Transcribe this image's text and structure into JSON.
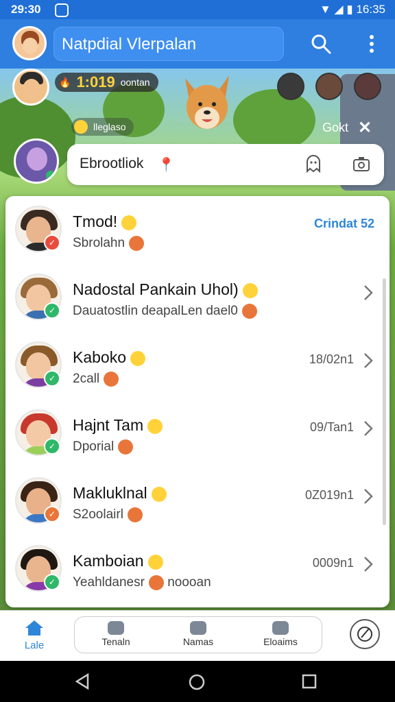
{
  "status_bar": {
    "time": "29:30",
    "right_time": "16:35"
  },
  "app_bar": {
    "title": "Natpdial Vlerpalan"
  },
  "story": {
    "count": "1:019",
    "badge_text": "oontan"
  },
  "activity": {
    "pill_text": "lleglaso",
    "close_label": "Gokt"
  },
  "composer": {
    "text": "Ebrootliok"
  },
  "chats": [
    {
      "name": "Tmod!",
      "message": "Sbrolahn",
      "time": "Crindat 52",
      "hair": "#3a2a22",
      "skin": "#e9b58e",
      "shirt": "#2b2b2b",
      "badge": "#e84c3d"
    },
    {
      "name": "Nadostal Pankain Uhol)",
      "message": "Dauatostlin deapalLen dael0",
      "time": "",
      "hair": "#9a6a3a",
      "skin": "#f1c6a0",
      "shirt": "#3a6fb0",
      "badge": "#2fb86a"
    },
    {
      "name": "Kaboko",
      "message": "2call",
      "time": "18/02n1",
      "hair": "#8a5a2a",
      "skin": "#f1c6a0",
      "shirt": "#7a3fa0",
      "badge": "#2fb86a"
    },
    {
      "name": "Hajnt Tam",
      "message": "Dporial",
      "time": "09/Tan1",
      "hair": "#c8382c",
      "skin": "#f4caa6",
      "shirt": "#9bcf5a",
      "badge": "#2fb86a"
    },
    {
      "name": "Makluklnal",
      "message": "S2oolairl",
      "time": "0Z019n1",
      "hair": "#3a2416",
      "skin": "#e8b18a",
      "shirt": "#3a78c4",
      "badge": "#e8763a"
    },
    {
      "name": "Kamboian",
      "message": "Yeahldanesr",
      "message_extra": "noooan",
      "time": "0009n1",
      "hair": "#1f1712",
      "skin": "#e9b58e",
      "shirt": "#8a3aa8",
      "badge": "#2fb86a"
    }
  ],
  "bottom_nav": {
    "home": "Lale",
    "tabs": [
      "Tenaln",
      "Namas",
      "Eloaims"
    ]
  }
}
